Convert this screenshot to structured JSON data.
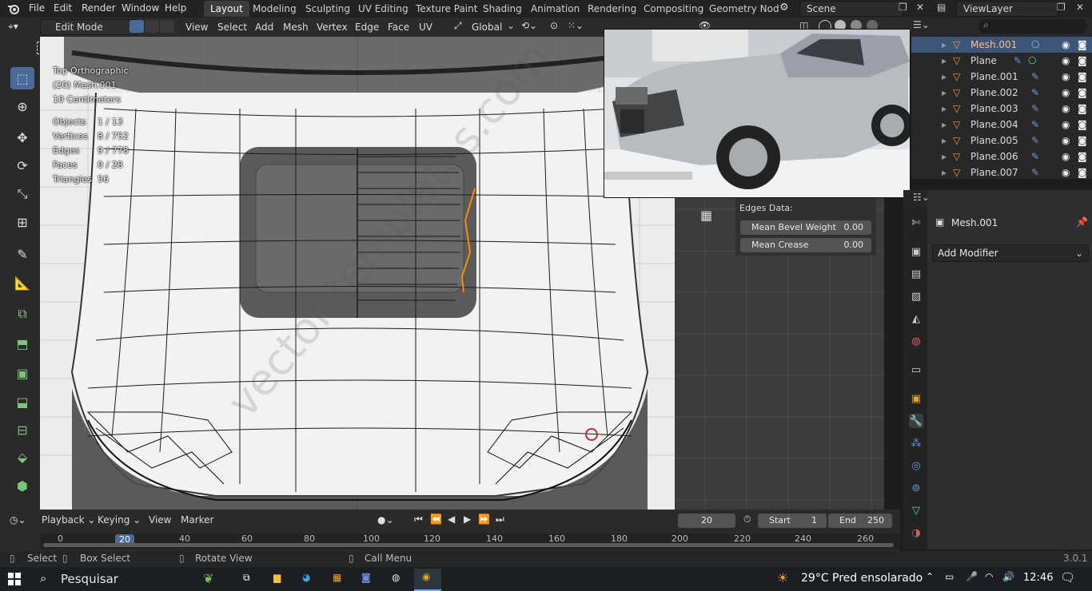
{
  "menu": [
    "File",
    "Edit",
    "Render",
    "Window",
    "Help"
  ],
  "workspaces": [
    "Layout",
    "Modeling",
    "Sculpting",
    "UV Editing",
    "Texture Paint",
    "Shading",
    "Animation",
    "Rendering",
    "Compositing",
    "Geometry Nod"
  ],
  "scene": "Scene",
  "view_layer": "ViewLayer",
  "header": {
    "mode": "Edit Mode",
    "menus": [
      "View",
      "Select",
      "Add",
      "Mesh",
      "Vertex",
      "Edge",
      "Face",
      "UV"
    ],
    "transform": "Global"
  },
  "viewport": {
    "view_name": "Top Orthographic",
    "object_name": "(20) Mesh.001",
    "units": "10 Centimeters",
    "stats": [
      {
        "label": "Objects",
        "value": "1 / 13"
      },
      {
        "label": "Vertices",
        "value": "8 / 752"
      },
      {
        "label": "Edges",
        "value": "9 / 778"
      },
      {
        "label": "Faces",
        "value": "0 / 28"
      },
      {
        "label": "Triangles",
        "value": "56"
      }
    ],
    "watermark": "vector-templates.com"
  },
  "edges_panel": {
    "title": "Edges Data:",
    "fields": [
      {
        "label": "Mean Bevel Weight",
        "value": "0.00"
      },
      {
        "label": "Mean Crease",
        "value": "0.00"
      }
    ]
  },
  "outliner": {
    "items": [
      {
        "name": "Mesh.001",
        "selected": true
      },
      {
        "name": "Plane",
        "selected": false
      },
      {
        "name": "Plane.001",
        "selected": false
      },
      {
        "name": "Plane.002",
        "selected": false
      },
      {
        "name": "Plane.003",
        "selected": false
      },
      {
        "name": "Plane.004",
        "selected": false
      },
      {
        "name": "Plane.005",
        "selected": false
      },
      {
        "name": "Plane.006",
        "selected": false
      },
      {
        "name": "Plane.007",
        "selected": false
      }
    ]
  },
  "properties": {
    "object": "Mesh.001",
    "add_modifier": "Add Modifier"
  },
  "timeline": {
    "menus": [
      "Playback",
      "Keying",
      "View",
      "Marker"
    ],
    "current_frame": "20",
    "start_label": "Start",
    "start": "1",
    "end_label": "End",
    "end": "250",
    "ticks": [
      "0",
      "20",
      "40",
      "60",
      "80",
      "100",
      "120",
      "140",
      "160",
      "180",
      "200",
      "220",
      "240",
      "260"
    ]
  },
  "status": {
    "items": [
      "Select",
      "Box Select",
      "Rotate View",
      "Call Menu"
    ],
    "version": "3.0.1"
  },
  "taskbar": {
    "search": "Pesquisar",
    "weather": "29°C  Pred ensolarado",
    "time": "12:46"
  },
  "colors": {
    "accent": "#4a6b9a",
    "selected_row": "#3c5579",
    "edge_selected": "#ff8a00"
  }
}
